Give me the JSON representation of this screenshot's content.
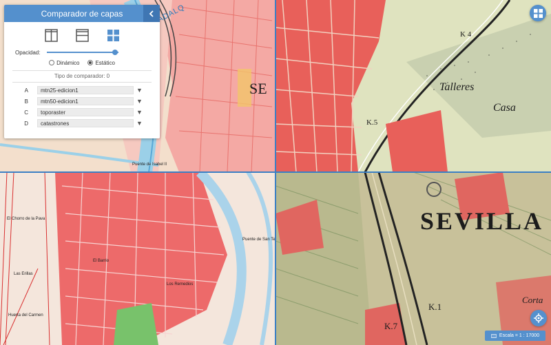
{
  "panel": {
    "title": "Comparador de capas",
    "opacity_label": "Opacidad:",
    "opacity_value": 0.95,
    "radio_dynamic": "Dinámico",
    "radio_static": "Estático",
    "radio_selected": "Estático",
    "comparator_type": "Tipo de comparador: 0",
    "layers": [
      {
        "letter": "A",
        "value": "mtn25-edicion1"
      },
      {
        "letter": "B",
        "value": "mtn50-edicion1"
      },
      {
        "letter": "C",
        "value": "toporaster"
      },
      {
        "letter": "D",
        "value": "catastrones"
      }
    ]
  },
  "map_labels": {
    "a_guadal": "GUADALQ",
    "a_se": "SE",
    "a_puente": "Puente de Isabel II",
    "b_talleres": "Talleres",
    "b_casa": "Casa",
    "b_k4": "K 4",
    "b_k5": "K.5",
    "c_puente": "Puente de San Te",
    "c_barrio": "El Barrio",
    "c_remedios": "Los Remedios",
    "c_carmen": "Huerta del Carmen",
    "c_erillas": "Las Erillas",
    "c_chorro": "El Chorro de la Pava",
    "d_sevilla": "SEVILLA",
    "d_k1": "K.1",
    "d_k7": "K.7",
    "d_corta": "Corta"
  },
  "scale": {
    "label": "Escala = 1 : 17000"
  },
  "colors": {
    "accent": "#5490cd",
    "urban": "#e8605a"
  }
}
